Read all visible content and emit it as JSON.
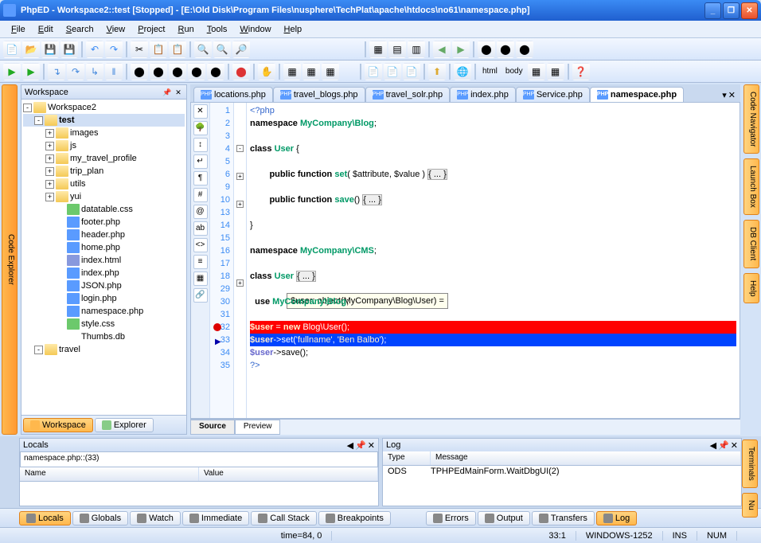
{
  "title": "PhpED - Workspace2::test [Stopped] - [E:\\Old Disk\\Program Files\\nusphere\\TechPlat\\apache\\htdocs\\no61\\namespace.php]",
  "menu": [
    "File",
    "Edit",
    "Search",
    "View",
    "Project",
    "Run",
    "Tools",
    "Window",
    "Help"
  ],
  "breadcrumb": [
    "html",
    "body"
  ],
  "sidetabs": {
    "left": "Code Explorer",
    "r1": "Code Navigator",
    "r2": "Launch Box",
    "r3": "DB Client",
    "r4": "Help",
    "r5": "Terminals",
    "r6": "Nu"
  },
  "workspace": {
    "title": "Workspace",
    "root": "Workspace2",
    "project": "test",
    "folders": [
      "images",
      "js",
      "my_travel_profile",
      "trip_plan",
      "utils",
      "yui"
    ],
    "files": [
      {
        "name": "datatable.css",
        "type": "css"
      },
      {
        "name": "footer.php",
        "type": "php"
      },
      {
        "name": "header.php",
        "type": "php"
      },
      {
        "name": "home.php",
        "type": "php"
      },
      {
        "name": "index.html",
        "type": "html"
      },
      {
        "name": "index.php",
        "type": "php"
      },
      {
        "name": "JSON.php",
        "type": "php"
      },
      {
        "name": "login.php",
        "type": "php"
      },
      {
        "name": "namespace.php",
        "type": "php"
      },
      {
        "name": "style.css",
        "type": "css"
      },
      {
        "name": "Thumbs.db",
        "type": "file"
      }
    ],
    "lastfolder": "travel",
    "tabs": [
      "Workspace",
      "Explorer"
    ]
  },
  "filetabs": [
    "locations.php",
    "travel_blogs.php",
    "travel_solr.php",
    "index.php",
    "Service.php",
    "namespace.php"
  ],
  "code": {
    "lines": [
      {
        "n": 1,
        "html": "<span class='tag'>&lt;?php</span>"
      },
      {
        "n": 2,
        "html": "<span class='kw'>namespace</span> <span class='cls'>MyCompany\\Blog</span>;"
      },
      {
        "n": 3,
        "html": ""
      },
      {
        "n": 4,
        "html": "<span class='kw'>class</span> <span class='cls'>User</span> {",
        "fold": "-"
      },
      {
        "n": 5,
        "html": ""
      },
      {
        "n": 6,
        "html": "        <span class='kw'>public function</span> <span class='cls'>set</span>( $attribute, $value ) <span style='background:#eee;border:1px solid #aaa;'>{ ... }</span>",
        "fold": "+"
      },
      {
        "n": 9,
        "html": ""
      },
      {
        "n": 10,
        "html": "        <span class='kw'>public function</span> <span class='cls'>save</span>() <span style='background:#eee;border:1px solid #aaa;'>{ ... }</span>",
        "fold": "+"
      },
      {
        "n": 13,
        "html": ""
      },
      {
        "n": 14,
        "html": "}"
      },
      {
        "n": 15,
        "html": ""
      },
      {
        "n": 16,
        "html": "<span class='kw'>namespace</span> <span class='cls'>MyCompany\\CMS</span>;"
      },
      {
        "n": 17,
        "html": ""
      },
      {
        "n": 18,
        "html": "<span class='kw'>class</span> <span class='cls'>User</span> <span style='background:#eee;border:1px solid #aaa;'>{ ... }</span>",
        "fold": "+"
      },
      {
        "n": 29,
        "html": ""
      },
      {
        "n": 30,
        "html": "  <span class='kw'>use</span> <span class='cls'>MyCompany\\Blog</span>;"
      },
      {
        "n": 31,
        "html": ""
      },
      {
        "n": 32,
        "html": "<span class='var'>$user</span> = <span class='kw'>new</span> Blog\\User();",
        "class": "hl-red",
        "bp": true
      },
      {
        "n": 33,
        "html": "<span class='var'>$user</span>-&gt;set(<span class='str'>'fullname'</span>, <span class='str'>'Ben Balbo'</span>);",
        "class": "hl-blue",
        "arrow": true
      },
      {
        "n": 34,
        "html": "<span class='var'>$user</span>-&gt;save();"
      },
      {
        "n": 35,
        "html": "<span class='tag'>?&gt;</span>"
      }
    ],
    "tooltip": "$user: object(MyCompany\\Blog\\User) ="
  },
  "srctabs": [
    "Source",
    "Preview"
  ],
  "locals": {
    "title": "Locals",
    "input": "namespace.php::(33)",
    "cols": [
      "Name",
      "Value"
    ]
  },
  "log": {
    "title": "Log",
    "cols": [
      "Type",
      "Message"
    ],
    "rows": [
      {
        "type": "ODS",
        "msg": "TPHPEdMainForm.WaitDbgUI(2)"
      }
    ]
  },
  "debugtabs_left": [
    "Locals",
    "Globals",
    "Watch",
    "Immediate",
    "Call Stack",
    "Breakpoints"
  ],
  "debugtabs_right": [
    "Errors",
    "Output",
    "Transfers",
    "Log"
  ],
  "status": {
    "time": "time=84, 0",
    "pos": "33:1",
    "enc": "WINDOWS-1252",
    "ins": "INS",
    "num": "NUM"
  }
}
